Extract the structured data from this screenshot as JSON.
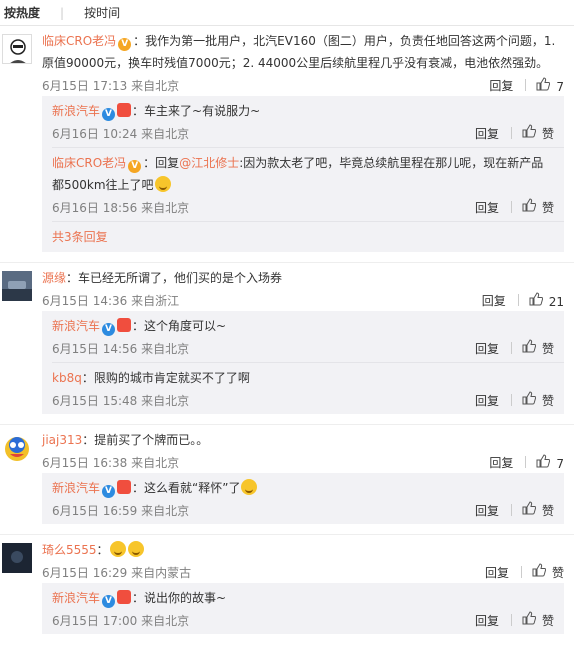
{
  "tabs": {
    "hot": "按热度",
    "sep": "|",
    "time": "按时间"
  },
  "icons": {
    "like": "thumbs-up-icon",
    "verified_orange": "verified-v-icon",
    "verified_blue": "verified-v-icon",
    "emoji": "grin-emoji-icon",
    "crown": "member-crown-icon"
  },
  "colors": {
    "link": "#eb7350",
    "meta": "#808080",
    "subbox_bg": "#f2f2f5"
  },
  "comments": [
    {
      "user": "临床CRO老冯",
      "text": "：我作为第一批用户，北汽EV160（图二）用户，负责任地回答这两个问题，1. 原值90000元，换车时残值7000元；2. 44000公里后续航里程几乎没有衰减，电池依然强劲。",
      "time": "6月15日 17:13 来自北京",
      "reply": "回复",
      "likes": "7",
      "replies": [
        {
          "user": "新浪汽车",
          "text": "：车主来了~有说服力~",
          "time": "6月16日 10:24 来自北京",
          "reply": "回复",
          "likes": "赞"
        },
        {
          "user": "临床CRO老冯",
          "text_prefix": "：回复",
          "mention": "@江北修士",
          "text": ":因为款太老了吧，毕竟总续航里程在那儿呢，现在新产品都500km往上了吧",
          "time": "6月16日 18:56 来自北京",
          "reply": "回复",
          "likes": "赞"
        }
      ],
      "more": "共3条回复"
    },
    {
      "user": "源缘",
      "text": "：车已经无所谓了，他们买的是个入场券",
      "time": "6月15日 14:36 来自浙江",
      "reply": "回复",
      "likes": "21",
      "replies": [
        {
          "user": "新浪汽车",
          "text": "：这个角度可以~",
          "time": "6月15日 14:56 来自北京",
          "reply": "回复",
          "likes": "赞"
        },
        {
          "user": "kb8q",
          "text": "：限购的城市肯定就买不了了啊",
          "time": "6月15日 15:48 来自北京",
          "reply": "回复",
          "likes": "赞"
        }
      ]
    },
    {
      "user": "jiaj313",
      "text": "：提前买了个牌而已。。",
      "time": "6月15日 16:38 来自北京",
      "reply": "回复",
      "likes": "7",
      "replies": [
        {
          "user": "新浪汽车",
          "text": "：这么看就“释怀”了",
          "time": "6月15日 16:59 来自北京",
          "reply": "回复",
          "likes": "赞"
        }
      ]
    },
    {
      "user": "琦么5555",
      "text": "：",
      "time": "6月15日 16:29 来自内蒙古",
      "reply": "回复",
      "likes": "赞",
      "replies": [
        {
          "user": "新浪汽车",
          "text": "：说出你的故事~",
          "time": "6月15日 17:00 来自北京",
          "reply": "回复",
          "likes": "赞"
        }
      ]
    }
  ]
}
